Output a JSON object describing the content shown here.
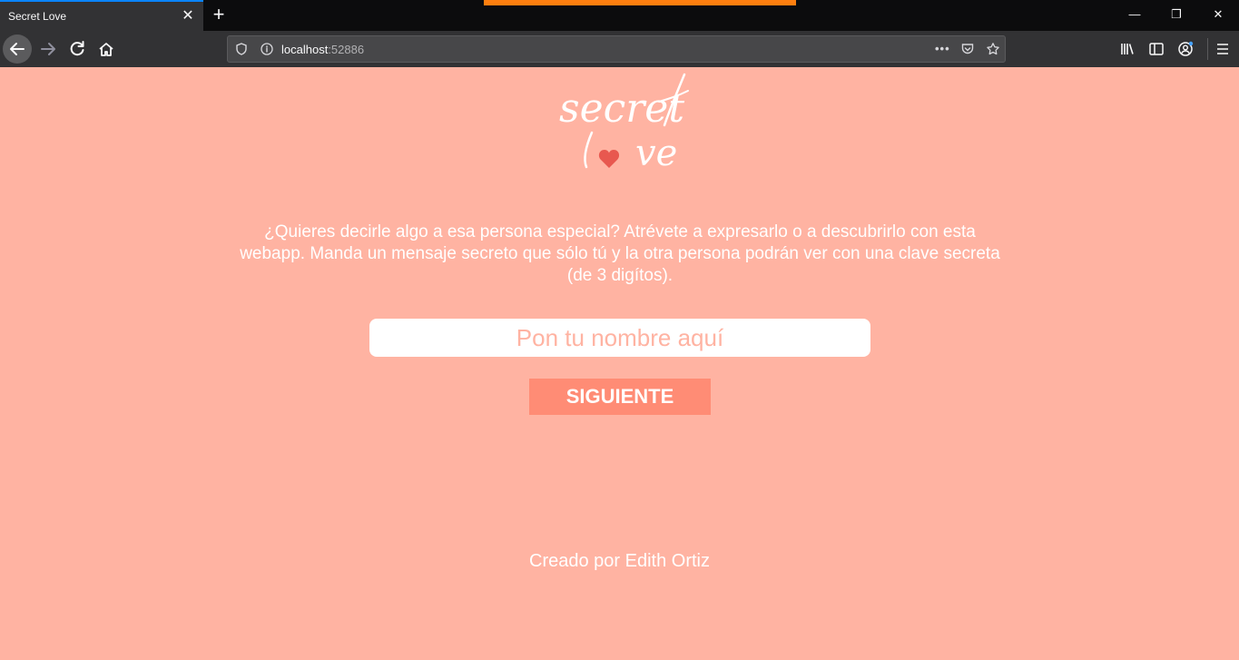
{
  "browser": {
    "tab_title": "Secret Love",
    "url_host": "localhost",
    "url_port": ":52886",
    "icons": {
      "close_tab": "close-icon",
      "new_tab": "plus-icon",
      "back": "arrow-left-icon",
      "forward": "arrow-right-icon",
      "reload": "reload-icon",
      "home": "home-icon",
      "shield": "shield-icon",
      "info": "info-icon",
      "page_actions": "more-horizontal-icon",
      "pocket": "pocket-icon",
      "bookmark": "star-icon",
      "library": "library-icon",
      "sidebar": "sidebar-icon",
      "account": "account-icon",
      "menu": "hamburger-menu-icon"
    },
    "accent_tab": "#0a84ff",
    "recording_color": "#ff7f0f"
  },
  "page": {
    "logo": {
      "line1": "secret",
      "line2_pre": "l",
      "line2_post": "ve",
      "heart_color": "#e8584f"
    },
    "intro": "¿Quieres decirle algo a esa persona especial? Atrévete a expresarlo o a descubrirlo con esta webapp. Manda un mensaje secreto que sólo tú y la otra persona podrán ver con una clave secreta (de 3 digítos).",
    "name_input": {
      "placeholder": "Pon tu nombre aquí",
      "value": ""
    },
    "next_button": "SIGUIENTE",
    "footer": "Creado por Edith Ortiz",
    "colors": {
      "background": "#ffb3a2",
      "button": "#ff8c75",
      "text": "#ffffff"
    }
  }
}
